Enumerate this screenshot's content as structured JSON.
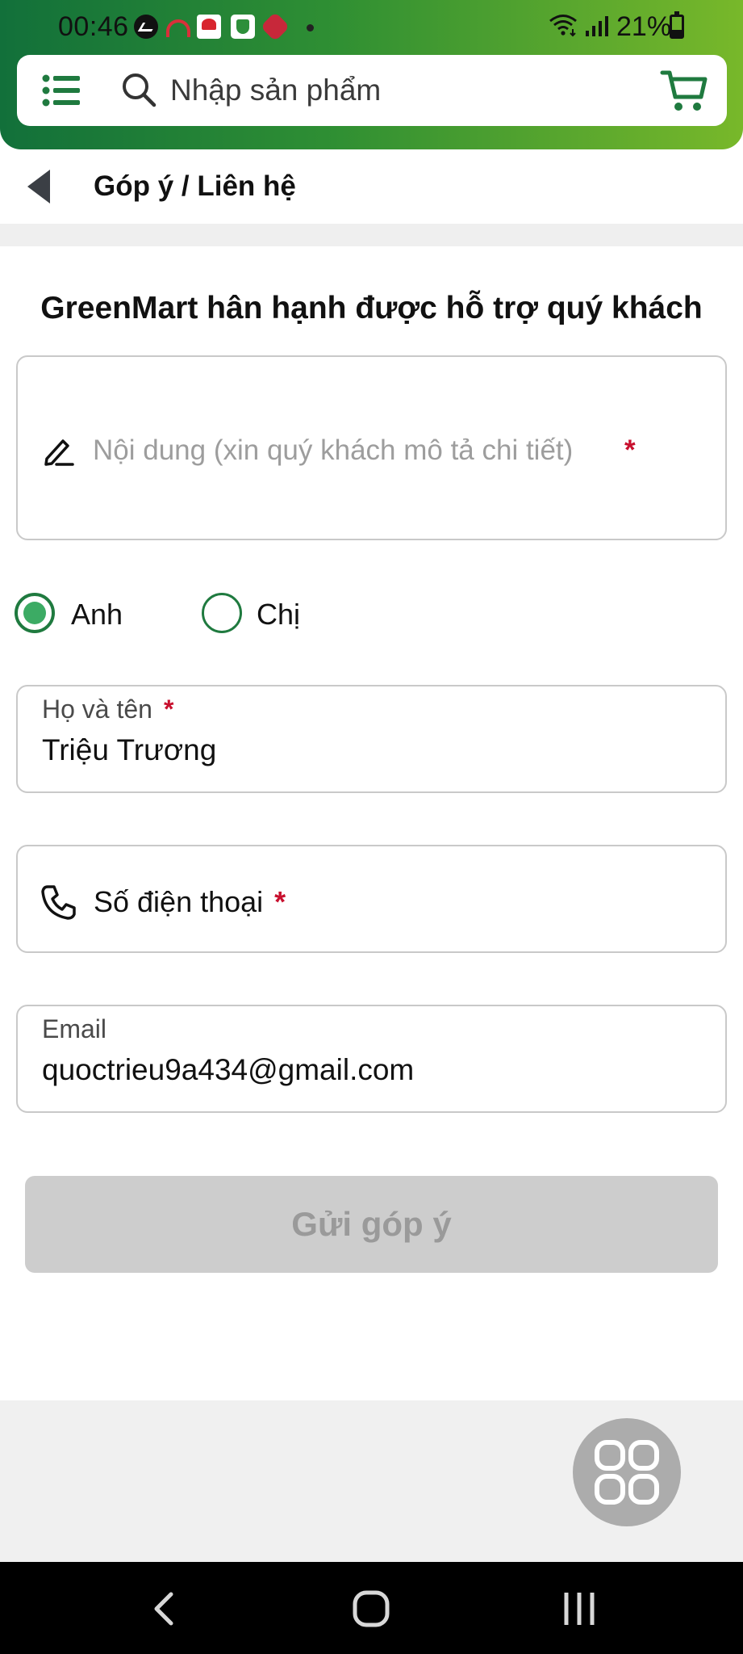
{
  "status_bar": {
    "time": "00:46",
    "battery": "21%"
  },
  "search": {
    "placeholder": "Nhập sản phẩm"
  },
  "page": {
    "title": "Góp ý / Liên hệ"
  },
  "form": {
    "heading": "GreenMart hân hạnh được hỗ trợ quý khách",
    "content_placeholder": "Nội dung (xin quý khách mô tả chi tiết)",
    "required_mark": "*",
    "salutation": {
      "options": [
        "Anh",
        "Chị"
      ],
      "selected": "Anh"
    },
    "name_label": "Họ và tên",
    "name_value": "Triệu Trương",
    "phone_label": "Số điện thoại",
    "email_label": "Email",
    "email_value": "quoctrieu9a434@gmail.com",
    "submit_label": "Gửi góp ý"
  },
  "colors": {
    "header_start": "#12703a",
    "header_end": "#78b82a",
    "accent_green": "#1f7a3f",
    "required_red": "#c8102e",
    "button_disabled": "#cdcdcd"
  }
}
